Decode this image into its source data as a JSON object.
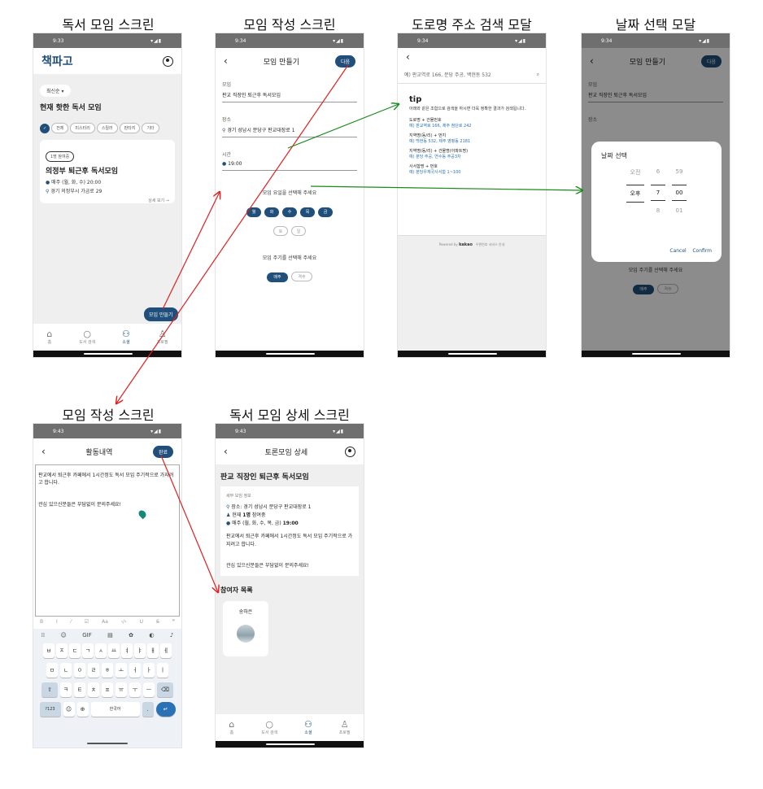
{
  "titles": {
    "s1": "독서 모임 스크린",
    "s2": "모임 작성 스크린",
    "s3": "도로명 주소 검색 모달",
    "s4": "날짜 선택 모달",
    "s5": "모임 작성 스크린",
    "s6": "독서 모임 상세 스크린"
  },
  "s1": {
    "time": "9:33",
    "brand": "책파고",
    "sort": "최신순",
    "heading": "현재 핫한 독서 모임",
    "chips": [
      "전체",
      "미스터리",
      "스릴러",
      "판타지",
      "기타"
    ],
    "badge": "1명 참여중",
    "card_title": "의정부 퇴근후 독서모임",
    "card_when": "매주 (월, 화, 수) 20:00",
    "card_where": "경기 의정부시 가금로 29",
    "card_more": "상세 보기 →",
    "fab": "모임 만들기"
  },
  "nav": {
    "home": "홈",
    "search": "도서 검색",
    "social": "소셜",
    "profile": "프로필"
  },
  "s2": {
    "time": "9:34",
    "title": "모임 만들기",
    "next": "다음",
    "label_name": "모임",
    "value_name": "판교 직장인 퇴근후 독서모임",
    "label_place": "장소",
    "value_place": "경기 성남시 분당구 판교대장로 1",
    "label_time": "시간",
    "value_time": "19:00",
    "days_prompt": "모임 요일을 선택해 주세요",
    "days": [
      "월",
      "화",
      "수",
      "목",
      "금"
    ],
    "days_off": [
      "토",
      "일"
    ],
    "cycle_prompt": "모임 주기를 선택해 주세요",
    "cycle_on": "매주",
    "cycle_off": "격주"
  },
  "s3": {
    "time": "9:34",
    "search_placeholder": "예) 판교역로 166, 분당 주공, 백현동 532",
    "tip_title": "tip",
    "tip_desc": "아래와 같은 조합으로 검색을 하시면 더욱 정확한 결과가 검색됩니다.",
    "items": [
      {
        "label": "도로명 + 건물번호",
        "example": "예) 판교역로 166, 제주 첨단로 242"
      },
      {
        "label": "지역명(동/리) + 번지",
        "example": "예) 백현동 532, 제주 영평동 2181"
      },
      {
        "label": "지역명(동/리) + 건물명(아파트명)",
        "example": "예) 분당 주공, 연수동 주공3차"
      },
      {
        "label": "사서함명 + 번호",
        "example": "예) 분당우체국사서함 1~100"
      }
    ],
    "powered": "Powered by",
    "kakao": "kakao",
    "privacy": "우편번호 서비스 안내"
  },
  "s4": {
    "time": "9:34",
    "title": "모임 만들기",
    "next": "다음",
    "dialog_title": "날짜 선택",
    "ampm_prev": "오전",
    "ampm": "오후",
    "hour_prev": "6",
    "hour": "7",
    "hour_next": "8",
    "min_prev": "59",
    "min": "00",
    "min_next": "01",
    "cancel": "Cancel",
    "confirm": "Confirm",
    "bg_label_name": "모임",
    "bg_value_name": "판교 직장인 퇴근후 독서모임",
    "bg_label_place": "장소",
    "bg_cycle_prompt": "모임 주기를 선택해 주세요",
    "bg_cycle_on": "매주",
    "bg_cycle_off": "격주"
  },
  "s5": {
    "time": "9:43",
    "title": "활동내역",
    "done": "완료",
    "line1": "판교에서 퇴근후 카페에서 1시간정도 독서 모임 주기적으로 가지려고 합니다.",
    "line2": "관심 있으신분들은 부담없이 문의주세요!",
    "toolbar": [
      "B",
      "I",
      "⁄",
      "☑",
      "Aa",
      "‹/›",
      "U",
      "S̶",
      "❞"
    ],
    "row1": [
      "ㅂ",
      "ㅈ",
      "ㄷ",
      "ㄱ",
      "ㅅ",
      "ㅛ",
      "ㅕ",
      "ㅑ",
      "ㅐ",
      "ㅔ"
    ],
    "row2": [
      "ㅁ",
      "ㄴ",
      "ㅇ",
      "ㄹ",
      "ㅎ",
      "ㅗ",
      "ㅓ",
      "ㅏ",
      "ㅣ"
    ],
    "row3": [
      "ㅋ",
      "ㅌ",
      "ㅊ",
      "ㅍ",
      "ㅠ",
      "ㅜ",
      "ㅡ"
    ],
    "key_123": "?123",
    "key_space": "한국어"
  },
  "s6": {
    "time": "9:43",
    "title": "토론모임 상세",
    "group_title": "판교 직장인 퇴근후 독서모임",
    "info_label": "세부 모임 정보",
    "place": "장소: 경기 성남시 분당구 판교대장로 1",
    "members_pre": "현재",
    "members_count": "1명",
    "members_post": "참여중",
    "schedule": "매주 (월, 화, 수, 목, 금)",
    "schedule_time": "19:00",
    "desc1": "판교에서 퇴근후 카페에서 1시간정도 독서 모임 주기적으로 가지려고 합니다.",
    "desc2": "관심 있으신분들은 부담없이 문의주세요!",
    "participants_title": "참여자 목록",
    "participant": "송하은"
  },
  "colors": {
    "accent": "#1f4f7a",
    "arrow_red": "#e02020",
    "arrow_green": "#1a8a1a",
    "link_blue": "#2a72b5"
  }
}
